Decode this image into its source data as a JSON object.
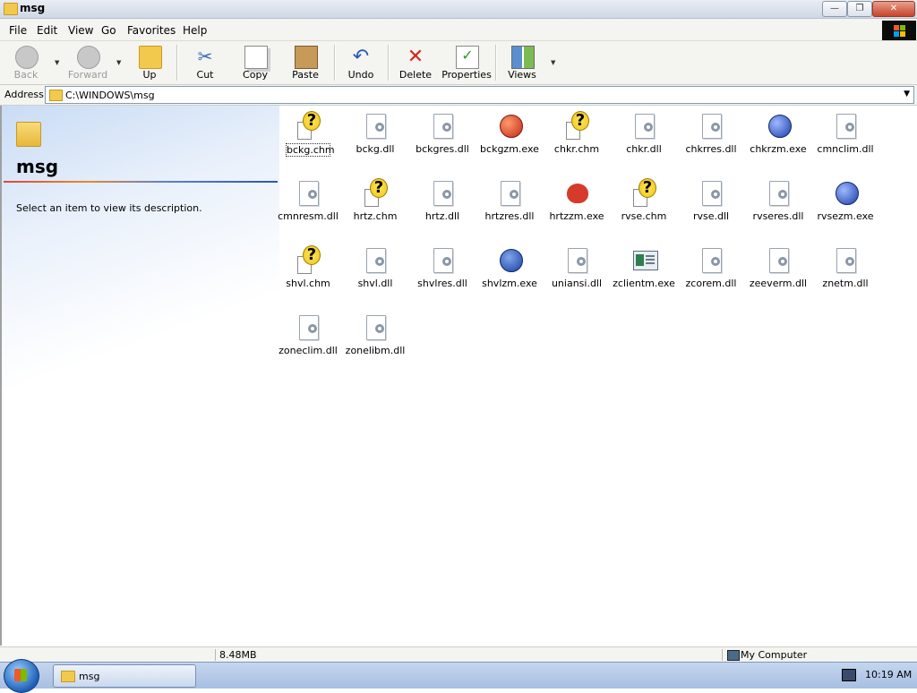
{
  "window": {
    "title": "msg"
  },
  "menu": [
    "File",
    "Edit",
    "View",
    "Go",
    "Favorites",
    "Help"
  ],
  "toolbar": {
    "back": "Back",
    "forward": "Forward",
    "up": "Up",
    "cut": "Cut",
    "copy": "Copy",
    "paste": "Paste",
    "undo": "Undo",
    "delete": "Delete",
    "properties": "Properties",
    "views": "Views"
  },
  "address": {
    "label": "Address",
    "value": "C:\\WINDOWS\\msg"
  },
  "left_pane": {
    "title": "msg",
    "description": "Select an item to view its description."
  },
  "files": [
    {
      "name": "bckg.chm",
      "icon": "help-file-icon",
      "selected": true
    },
    {
      "name": "bckg.dll",
      "icon": "dll-file-icon"
    },
    {
      "name": "bckgres.dll",
      "icon": "dll-file-icon"
    },
    {
      "name": "bckgzm.exe",
      "icon": "backgammon-exe-icon"
    },
    {
      "name": "chkr.chm",
      "icon": "help-file-icon"
    },
    {
      "name": "chkr.dll",
      "icon": "dll-file-icon"
    },
    {
      "name": "chkrres.dll",
      "icon": "dll-file-icon"
    },
    {
      "name": "chkrzm.exe",
      "icon": "checkers-exe-icon"
    },
    {
      "name": "cmnclim.dll",
      "icon": "dll-file-icon"
    },
    {
      "name": "cmnresm.dll",
      "icon": "dll-file-icon"
    },
    {
      "name": "hrtz.chm",
      "icon": "help-file-icon"
    },
    {
      "name": "hrtz.dll",
      "icon": "dll-file-icon"
    },
    {
      "name": "hrtzres.dll",
      "icon": "dll-file-icon"
    },
    {
      "name": "hrtzzm.exe",
      "icon": "hearts-exe-icon"
    },
    {
      "name": "rvse.chm",
      "icon": "help-file-icon"
    },
    {
      "name": "rvse.dll",
      "icon": "dll-file-icon"
    },
    {
      "name": "rvseres.dll",
      "icon": "dll-file-icon"
    },
    {
      "name": "rvsezm.exe",
      "icon": "reversi-exe-icon"
    },
    {
      "name": "shvl.chm",
      "icon": "help-file-icon"
    },
    {
      "name": "shvl.dll",
      "icon": "dll-file-icon"
    },
    {
      "name": "shvlres.dll",
      "icon": "dll-file-icon"
    },
    {
      "name": "shvlzm.exe",
      "icon": "spades-exe-icon"
    },
    {
      "name": "uniansi.dll",
      "icon": "dll-file-icon"
    },
    {
      "name": "zclientm.exe",
      "icon": "application-exe-icon"
    },
    {
      "name": "zcorem.dll",
      "icon": "dll-file-icon"
    },
    {
      "name": "zeeverm.dll",
      "icon": "dll-file-icon"
    },
    {
      "name": "znetm.dll",
      "icon": "dll-file-icon"
    },
    {
      "name": "zoneclim.dll",
      "icon": "dll-file-icon"
    },
    {
      "name": "zonelibm.dll",
      "icon": "dll-file-icon"
    }
  ],
  "status": {
    "size": "8.48MB",
    "location": "My Computer"
  },
  "taskbar": {
    "task": "msg",
    "clock": "10:19 AM"
  }
}
